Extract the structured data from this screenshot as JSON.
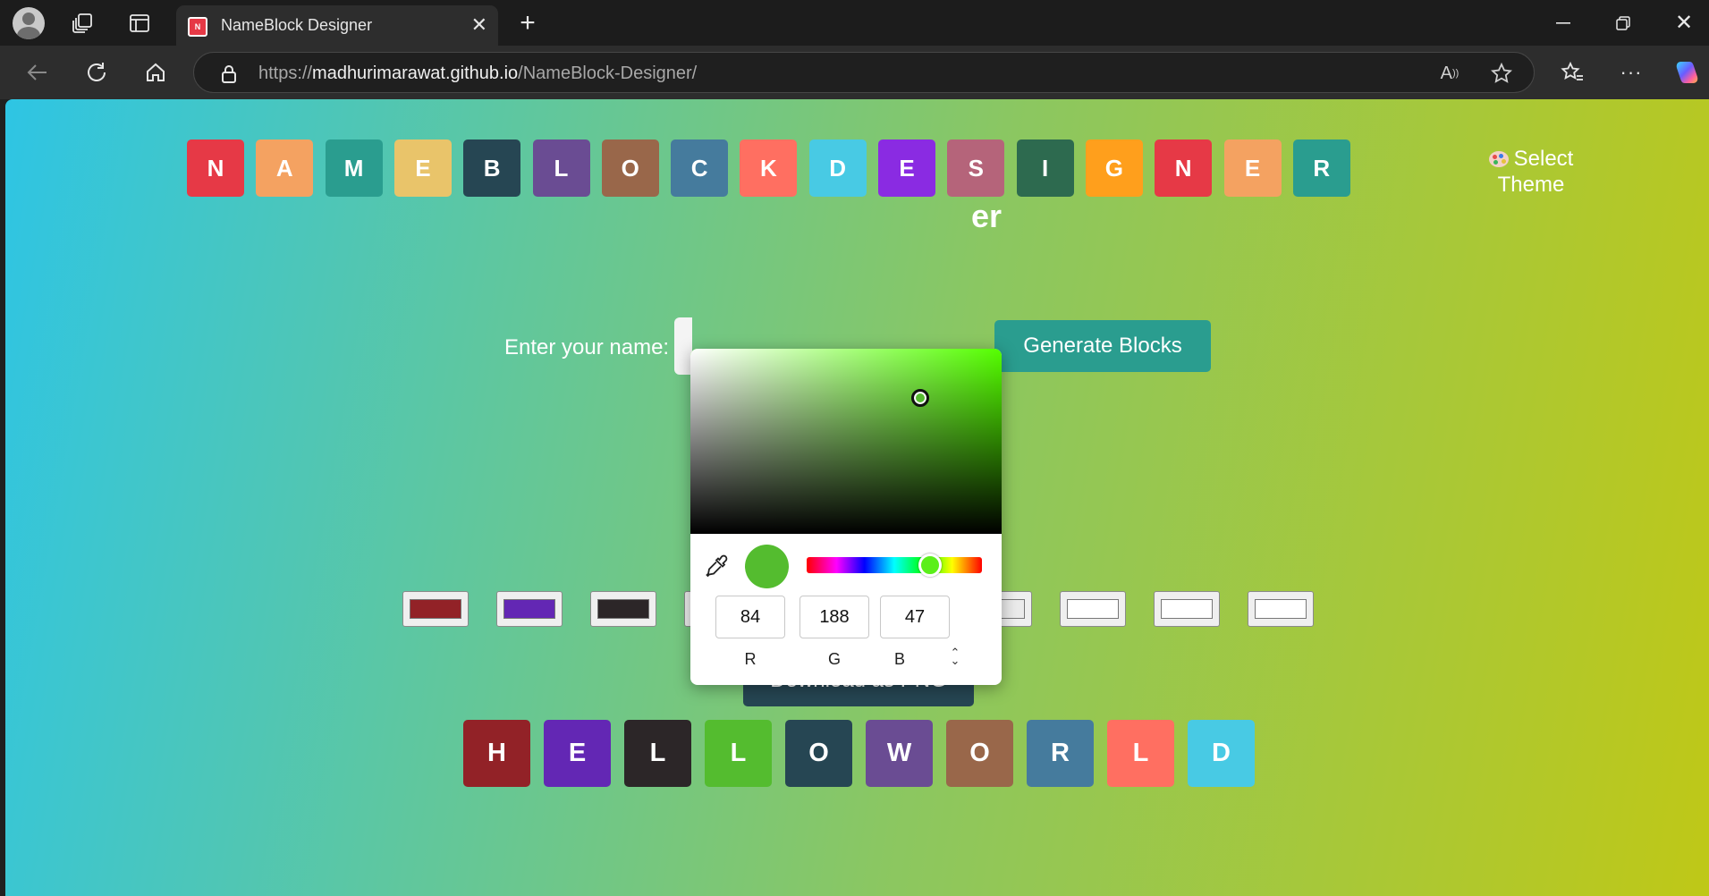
{
  "browser": {
    "tab_title": "NameBlock Designer",
    "favicon_text": "N",
    "url_scheme": "https://",
    "url_host": "madhurimarawat.github.io",
    "url_path": "/NameBlock-Designer/"
  },
  "header": {
    "title_letters": [
      {
        "char": "N",
        "color": "#e63946"
      },
      {
        "char": "A",
        "color": "#f4a261"
      },
      {
        "char": "M",
        "color": "#2a9d8f"
      },
      {
        "char": "E",
        "color": "#e9c46a"
      },
      {
        "char": "B",
        "color": "#264653"
      },
      {
        "char": "L",
        "color": "#6a4c93"
      },
      {
        "char": "O",
        "color": "#99674a"
      },
      {
        "char": "C",
        "color": "#457b9d"
      },
      {
        "char": "K",
        "color": "#ff6f61"
      },
      {
        "char": "D",
        "color": "#48cae4"
      },
      {
        "char": "E",
        "color": "#8a2be2"
      },
      {
        "char": "S",
        "color": "#b5647a"
      },
      {
        "char": "I",
        "color": "#2d6a4f"
      },
      {
        "char": "G",
        "color": "#ff9f1c"
      },
      {
        "char": "N",
        "color": "#e63946"
      },
      {
        "char": "E",
        "color": "#f4a261"
      },
      {
        "char": "R",
        "color": "#2a9d8f"
      }
    ],
    "theme_button": "Select Theme",
    "page_title_visible": "er"
  },
  "form": {
    "name_label": "Enter your name:",
    "generate_button": "Generate Blocks",
    "download_button": "Download as PNG"
  },
  "swatches": [
    "#922227",
    "#6327b4",
    "#2c2628",
    "#54bc2f",
    "#dcdcdc",
    "#dcdcdc",
    "#ebebeb",
    "#ffffff",
    "#ffffff",
    "#ffffff"
  ],
  "output_letters": [
    {
      "char": "H",
      "color": "#922227"
    },
    {
      "char": "E",
      "color": "#6327b4"
    },
    {
      "char": "L",
      "color": "#2c2628"
    },
    {
      "char": "L",
      "color": "#54bc2f"
    },
    {
      "char": "O",
      "color": "#264653"
    },
    {
      "char": "W",
      "color": "#6a4c93"
    },
    {
      "char": "O",
      "color": "#99674a"
    },
    {
      "char": "R",
      "color": "#457b9d"
    },
    {
      "char": "L",
      "color": "#ff6f61"
    },
    {
      "char": "D",
      "color": "#48cae4"
    }
  ],
  "color_picker": {
    "r": "84",
    "g": "188",
    "b": "47",
    "r_label": "R",
    "g_label": "G",
    "b_label": "B",
    "current_color": "#54bc2f",
    "hue_color": "#55ff00"
  }
}
